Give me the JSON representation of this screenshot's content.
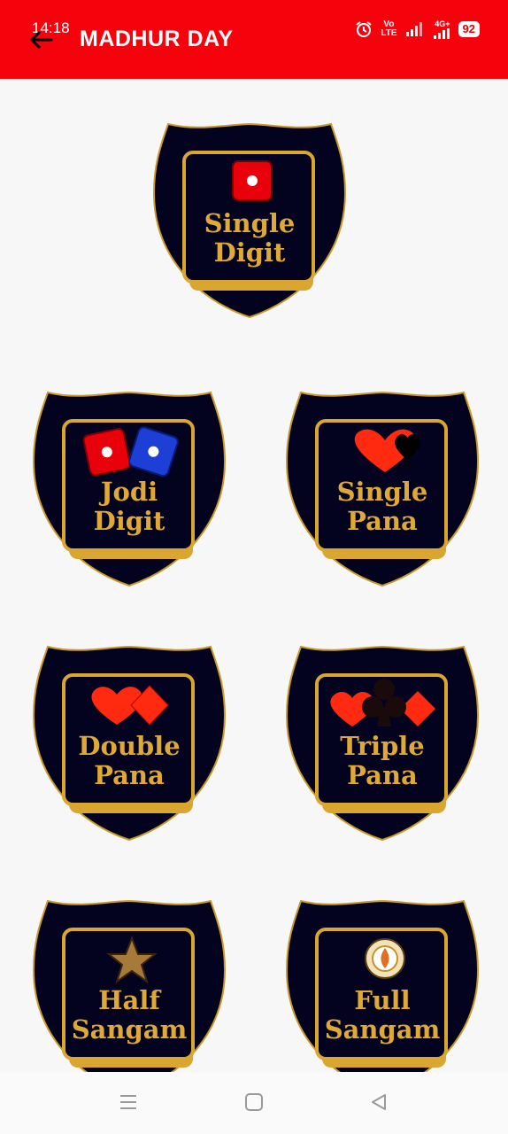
{
  "status_bar": {
    "time": "14:18",
    "volte": "Vo",
    "lte": "LTE",
    "network": "4G+",
    "battery": "92"
  },
  "header": {
    "title": "MADHUR DAY",
    "background_color": "#f5020c"
  },
  "tiles": [
    {
      "id": "single-digit",
      "line1": "Single",
      "line2": "Digit",
      "icon": "single-die-icon"
    },
    {
      "id": "jodi-digit",
      "line1": "Jodi",
      "line2": "Digit",
      "icon": "two-dice-icon"
    },
    {
      "id": "single-pana",
      "line1": "Single",
      "line2": "Pana",
      "icon": "heart-spade-icon"
    },
    {
      "id": "double-pana",
      "line1": "Double",
      "line2": "Pana",
      "icon": "heart-diamond-icon"
    },
    {
      "id": "triple-pana",
      "line1": "Triple",
      "line2": "Pana",
      "icon": "heart-club-diamond-icon"
    },
    {
      "id": "half-sangam",
      "line1": "Half",
      "line2": "Sangam",
      "icon": "star-icon"
    },
    {
      "id": "full-sangam",
      "line1": "Full",
      "line2": "Sangam",
      "icon": "emblem-icon"
    }
  ],
  "colors": {
    "shield_fill": "#03031f",
    "gold": "#d9a62f",
    "label": "#e0a935"
  }
}
